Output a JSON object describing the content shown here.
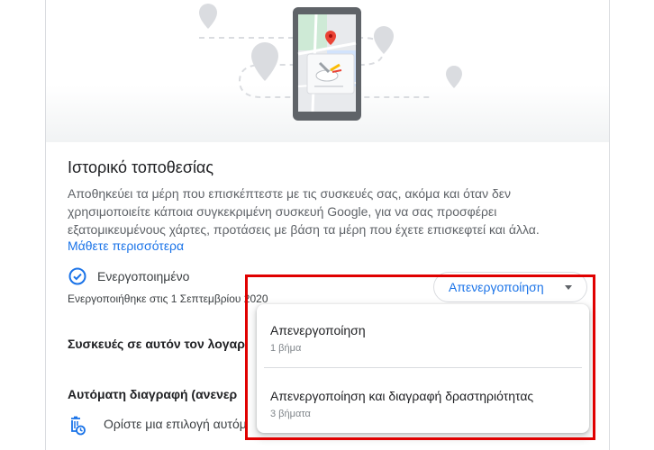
{
  "card": {
    "title": "Ιστορικό τοποθεσίας",
    "description": "Αποθηκεύει τα μέρη που επισκέπτεστε με τις συσκευές σας, ακόμα και όταν δεν χρησιμοποιείτε κάποια συγκεκριμένη συσκευή Google, για να σας προσφέρει εξατομικευμένους χάρτες, προτάσεις με βάση τα μέρη που έχετε επισκεφτεί και άλλα.",
    "learn_more": "Μάθετε περισσότερα"
  },
  "status": {
    "label": "Ενεργοποιημένο",
    "date": "Ενεργοποιήθηκε στις 1 Σεπτεμβρίου 2020",
    "icon": "check-circle-icon"
  },
  "pause_button": {
    "label": "Απενεργοποίηση",
    "icon": "dropdown-caret-icon"
  },
  "rows": {
    "devices": "Συσκευές σε αυτόν τον λογαρ",
    "auto_delete": "Αυτόματη διαγραφή (ανενερ",
    "auto_delete_option": "Ορίστε μια επιλογή αυτόμ"
  },
  "menu": {
    "items": [
      {
        "title": "Απενεργοποίηση",
        "subtitle": "1 βήμα"
      },
      {
        "title": "Απενεργοποίηση και διαγραφή δραστηριότητας",
        "subtitle": "3 βήματα"
      }
    ]
  },
  "colors": {
    "accent": "#1a73e8",
    "highlight": "#e00000",
    "text_secondary": "#5f6368"
  }
}
